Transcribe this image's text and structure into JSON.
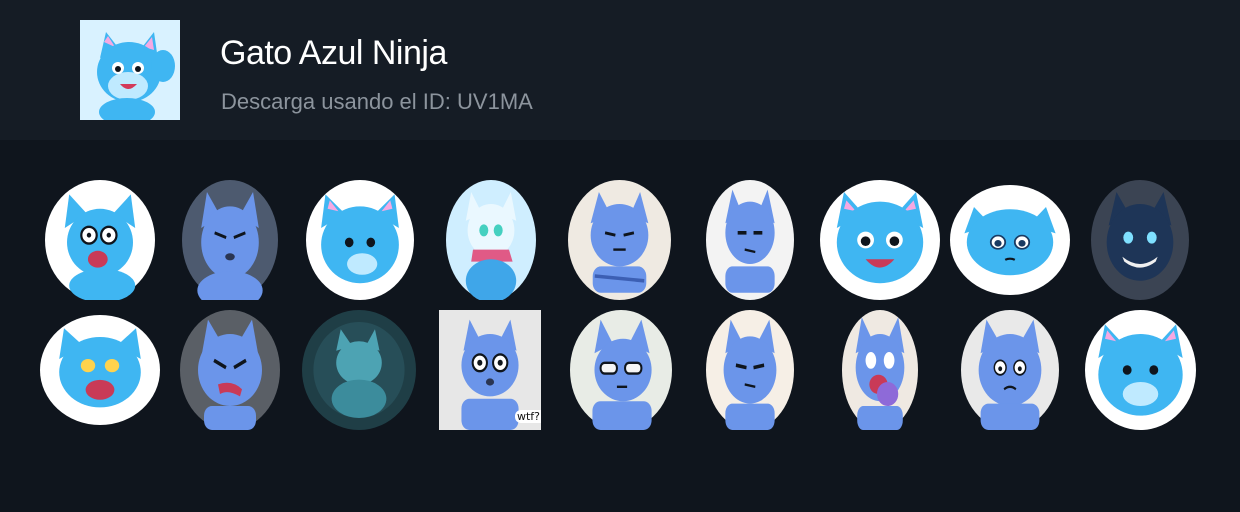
{
  "pack": {
    "title": "Gato Azul Ninja",
    "subtitle": "Descarga usando el ID: UV1MA",
    "thumbnail_icon": "blue-cat-waving-icon"
  },
  "colors": {
    "header_bg": "#151c25",
    "page_bg": "#0f151d",
    "title": "#ffffff",
    "subtitle": "#8c949d",
    "cat_blue": "#6b95ea",
    "cat_cyan": "#3fb6f2"
  },
  "stickers": [
    {
      "icon": "cat-surprised-glasses-sticker"
    },
    {
      "icon": "cat-annoyed-sticker"
    },
    {
      "icon": "cat-neutral-face-sticker"
    },
    {
      "icon": "cat-winter-scarf-sticker"
    },
    {
      "icon": "cat-arms-crossed-sticker"
    },
    {
      "icon": "cat-arms-crossed-unimpressed-sticker"
    },
    {
      "icon": "cat-happy-smile-sticker"
    },
    {
      "icon": "cat-teary-eyes-sticker"
    },
    {
      "icon": "cat-dark-grin-sticker"
    },
    {
      "icon": "cat-shouting-star-eyes-sticker"
    },
    {
      "icon": "cat-angry-yell-sticker"
    },
    {
      "icon": "cat-dark-teal-scene-sticker"
    },
    {
      "icon": "cat-wtf-sticker"
    },
    {
      "icon": "cat-sunglasses-sticker"
    },
    {
      "icon": "cat-suspicious-sticker"
    },
    {
      "icon": "cat-crying-covering-mouth-sticker"
    },
    {
      "icon": "cat-worried-sticker"
    },
    {
      "icon": "cat-cute-smile-sticker"
    }
  ],
  "stickers_extra_text": {
    "wtf_caption": "wtf?!"
  }
}
